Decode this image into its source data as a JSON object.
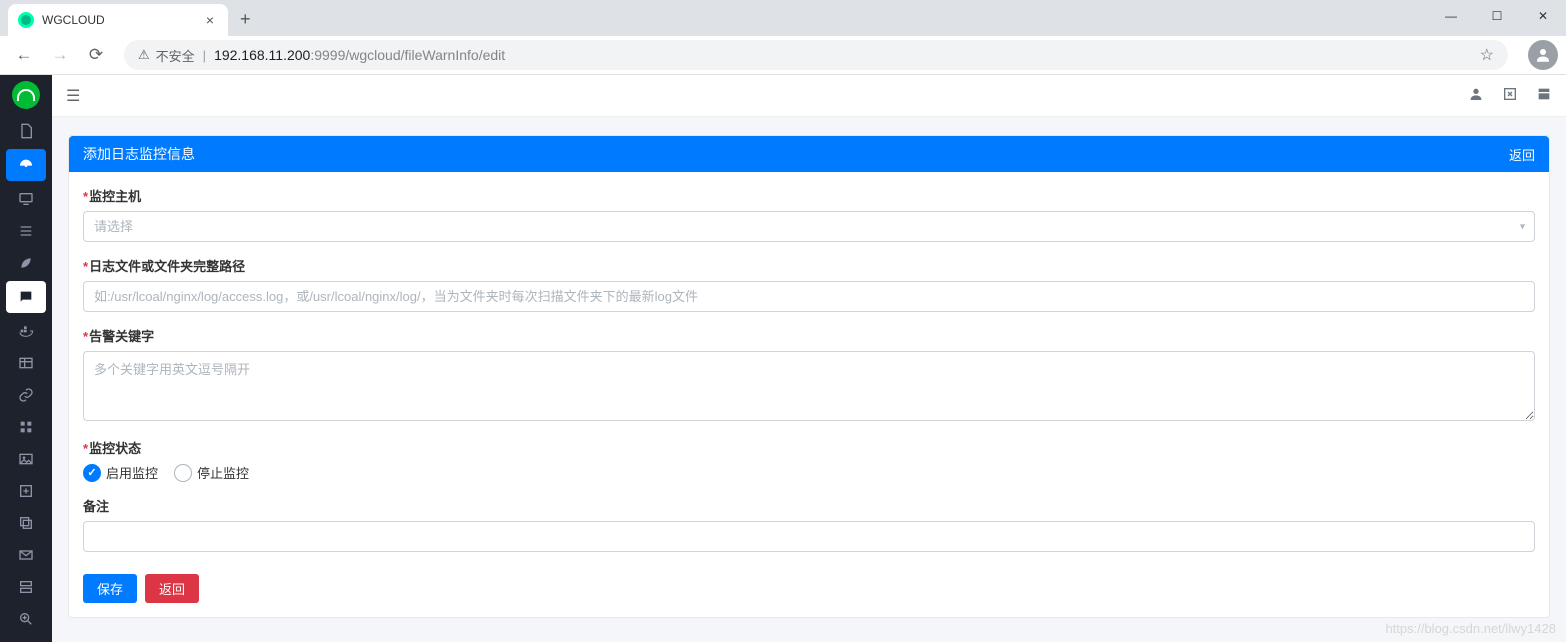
{
  "browser": {
    "tab_title": "WGCLOUD",
    "insecure_label": "不安全",
    "url_host": "192.168.11.200",
    "url_port_path": ":9999/wgcloud/fileWarnInfo/edit"
  },
  "panel": {
    "title": "添加日志监控信息",
    "back": "返回"
  },
  "form": {
    "host_label": "监控主机",
    "host_placeholder": "请选择",
    "path_label": "日志文件或文件夹完整路径",
    "path_placeholder": "如:/usr/lcoal/nginx/log/access.log，或/usr/lcoal/nginx/log/，当为文件夹时每次扫描文件夹下的最新log文件",
    "keyword_label": "告警关键字",
    "keyword_placeholder": "多个关键字用英文逗号隔开",
    "status_label": "监控状态",
    "status_enable": "启用监控",
    "status_disable": "停止监控",
    "remark_label": "备注",
    "save": "保存",
    "cancel": "返回"
  },
  "watermark": "https://blog.csdn.net/llwy1428"
}
